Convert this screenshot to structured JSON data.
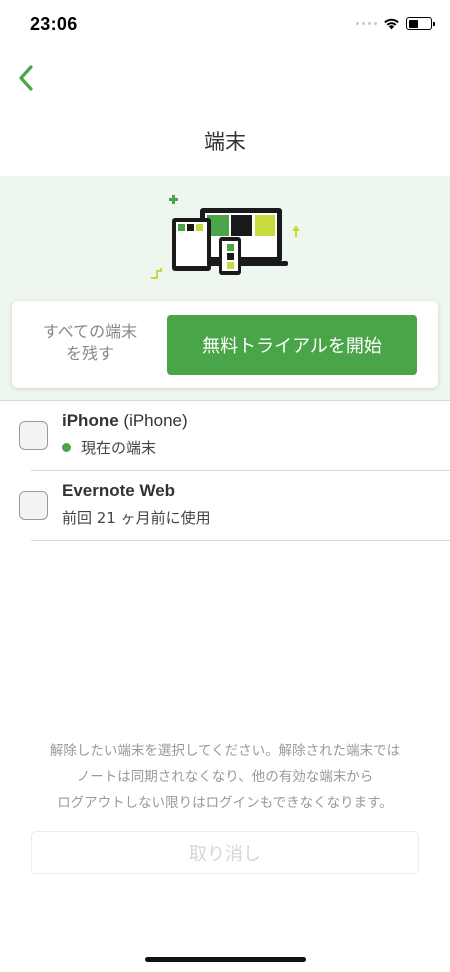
{
  "status_bar": {
    "time": "23:06",
    "battery_level": 0.45
  },
  "header": {
    "back_icon": "chevron-left-icon",
    "title": "端末"
  },
  "colors": {
    "accent": "#4aa548",
    "hero_bg": "#eef6f0",
    "illustration_yellow": "#c7dc3c",
    "illustration_dark": "#1a1a1a"
  },
  "promo": {
    "illustration": "devices-illustration",
    "keep_all_label": "すべての端末を残す",
    "trial_button_label": "無料トライアルを開始"
  },
  "devices": [
    {
      "name": "iPhone",
      "model": "(iPhone)",
      "status": "現在の端末",
      "current": true,
      "checked": false
    },
    {
      "name": "Evernote Web",
      "model": "",
      "status": "前回 21 ヶ月前に使用",
      "current": false,
      "checked": false
    }
  ],
  "footer": {
    "notice": "解除したい端末を選択してください。解除された端末ではノートは同期されなくなり、他の有効な端末からログアウトしない限りはログインもできなくなります。",
    "cancel_label": "取り消し"
  }
}
